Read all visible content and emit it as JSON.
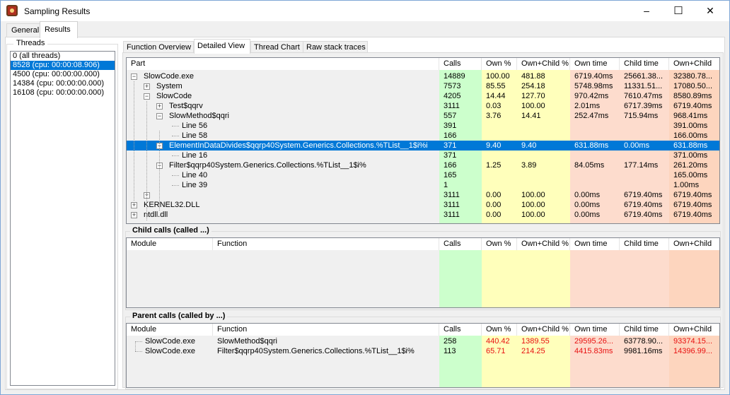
{
  "window": {
    "title": "Sampling Results",
    "controls": {
      "minimize": "–",
      "maximize": "☐",
      "close": "✕"
    }
  },
  "main_tabs": [
    {
      "label": "General",
      "active": false
    },
    {
      "label": "Results",
      "active": true
    }
  ],
  "threads": {
    "group_label": "Threads",
    "items": [
      {
        "label": "0 (all threads)",
        "selected": false
      },
      {
        "label": "8528 (cpu: 00:00:08.906)",
        "selected": true
      },
      {
        "label": "4500 (cpu: 00:00:00.000)",
        "selected": false
      },
      {
        "label": "14384 (cpu: 00:00:00.000)",
        "selected": false
      },
      {
        "label": "16108 (cpu: 00:00:00.000)",
        "selected": false
      }
    ]
  },
  "sub_tabs": [
    {
      "label": "Function Overview",
      "active": false
    },
    {
      "label": "Detailed View",
      "active": true
    },
    {
      "label": "Thread Chart",
      "active": false
    },
    {
      "label": "Raw stack traces",
      "active": false
    }
  ],
  "colors": {
    "calls_bg": "#ccffcc",
    "pct_bg": "#ffffbb",
    "time_bg": "#fddccd",
    "ownchild_bg": "#fdd5be",
    "selection": "#0078d7",
    "warning_text": "#e81010"
  },
  "detail_tree": {
    "columns": [
      "Part",
      "Calls",
      "Own %",
      "Own+Child %",
      "Own time",
      "Child time",
      "Own+Child"
    ],
    "rows": [
      {
        "label": "SlowCode.exe",
        "level": 0,
        "toggle": "minus",
        "calls": "14889",
        "own_pct": "100.00",
        "oc_pct": "481.88",
        "own_time": "6719.40ms",
        "child_time": "25661.38...",
        "own_child": "32380.78..."
      },
      {
        "label": "System",
        "level": 1,
        "toggle": "plus",
        "calls": "7573",
        "own_pct": "85.55",
        "oc_pct": "254.18",
        "own_time": "5748.98ms",
        "child_time": "11331.51...",
        "own_child": "17080.50..."
      },
      {
        "label": "SlowCode",
        "level": 1,
        "toggle": "minus",
        "calls": "4205",
        "own_pct": "14.44",
        "oc_pct": "127.70",
        "own_time": "970.42ms",
        "child_time": "7610.47ms",
        "own_child": "8580.89ms"
      },
      {
        "label": "Test$qqrv",
        "level": 2,
        "toggle": "plus",
        "calls": "3111",
        "own_pct": "0.03",
        "oc_pct": "100.00",
        "own_time": "2.01ms",
        "child_time": "6717.39ms",
        "own_child": "6719.40ms"
      },
      {
        "label": "SlowMethod$qqri",
        "level": 2,
        "toggle": "minus",
        "calls": "557",
        "own_pct": "3.76",
        "oc_pct": "14.41",
        "own_time": "252.47ms",
        "child_time": "715.94ms",
        "own_child": "968.41ms"
      },
      {
        "label": "Line 56",
        "level": 3,
        "toggle": "",
        "calls": "391",
        "own_pct": "",
        "oc_pct": "",
        "own_time": "",
        "child_time": "",
        "own_child": "391.00ms"
      },
      {
        "label": "Line 58",
        "level": 3,
        "toggle": "",
        "calls": "166",
        "own_pct": "",
        "oc_pct": "",
        "own_time": "",
        "child_time": "",
        "own_child": "166.00ms"
      },
      {
        "label": "ElementInDataDivides$qqrp40System.Generics.Collections.%TList__1$i%i",
        "level": 2,
        "toggle": "minus",
        "selected": true,
        "calls": "371",
        "own_pct": "9.40",
        "oc_pct": "9.40",
        "own_time": "631.88ms",
        "child_time": "0.00ms",
        "own_child": "631.88ms"
      },
      {
        "label": "Line 16",
        "level": 3,
        "toggle": "",
        "calls": "371",
        "own_pct": "",
        "oc_pct": "",
        "own_time": "",
        "child_time": "",
        "own_child": "371.00ms"
      },
      {
        "label": "Filter$qqrp40System.Generics.Collections.%TList__1$i%",
        "level": 2,
        "toggle": "minus",
        "calls": "166",
        "own_pct": "1.25",
        "oc_pct": "3.89",
        "own_time": "84.05ms",
        "child_time": "177.14ms",
        "own_child": "261.20ms"
      },
      {
        "label": "Line 40",
        "level": 3,
        "toggle": "",
        "calls": "165",
        "own_pct": "",
        "oc_pct": "",
        "own_time": "",
        "child_time": "",
        "own_child": "165.00ms"
      },
      {
        "label": "Line 39",
        "level": 3,
        "toggle": "",
        "calls": "1",
        "own_pct": "",
        "oc_pct": "",
        "own_time": "",
        "child_time": "",
        "own_child": "1.00ms"
      },
      {
        "label": "",
        "level": 1,
        "toggle": "plus",
        "calls": "3111",
        "own_pct": "0.00",
        "oc_pct": "100.00",
        "own_time": "0.00ms",
        "child_time": "6719.40ms",
        "own_child": "6719.40ms"
      },
      {
        "label": "KERNEL32.DLL",
        "level": 0,
        "toggle": "plus",
        "calls": "3111",
        "own_pct": "0.00",
        "oc_pct": "100.00",
        "own_time": "0.00ms",
        "child_time": "6719.40ms",
        "own_child": "6719.40ms"
      },
      {
        "label": "ntdll.dll",
        "level": 0,
        "toggle": "plus",
        "calls": "3111",
        "own_pct": "0.00",
        "oc_pct": "100.00",
        "own_time": "0.00ms",
        "child_time": "6719.40ms",
        "own_child": "6719.40ms"
      }
    ]
  },
  "child_calls": {
    "title": "Child calls (called ...)",
    "columns": [
      "Module",
      "Function",
      "Calls",
      "Own %",
      "Own+Child %",
      "Own time",
      "Child time",
      "Own+Child"
    ],
    "rows": []
  },
  "parent_calls": {
    "title": "Parent calls (called by ...)",
    "columns": [
      "Module",
      "Function",
      "Calls",
      "Own %",
      "Own+Child %",
      "Own time",
      "Child time",
      "Own+Child"
    ],
    "rows": [
      {
        "module": "SlowCode.exe",
        "function": "SlowMethod$qqri",
        "calls": "258",
        "own_pct": "440.42",
        "oc_pct": "1389.55",
        "own_time": "29595.26...",
        "child_time": "63778.90...",
        "own_child": "93374.15..."
      },
      {
        "module": "SlowCode.exe",
        "function": "Filter$qqrp40System.Generics.Collections.%TList__1$i%",
        "calls": "113",
        "own_pct": "65.71",
        "oc_pct": "214.25",
        "own_time": "4415.83ms",
        "child_time": "9981.16ms",
        "own_child": "14396.99..."
      }
    ]
  }
}
